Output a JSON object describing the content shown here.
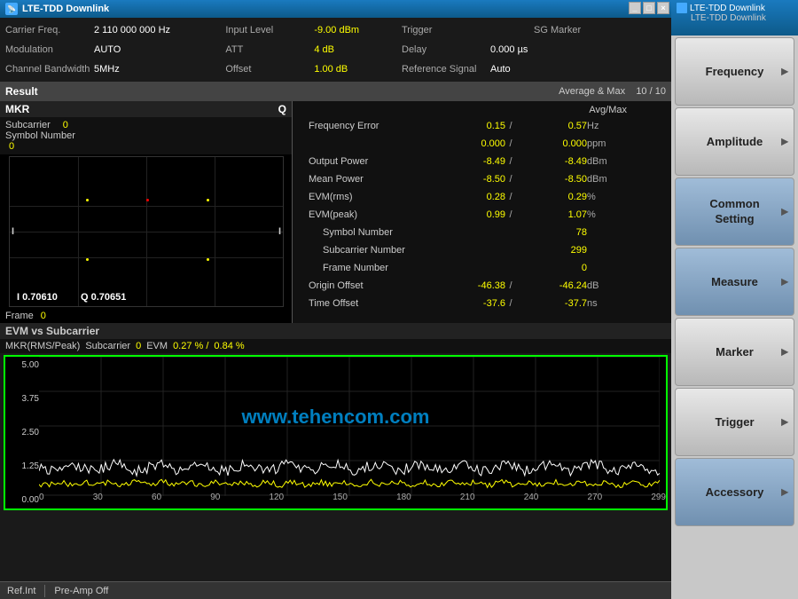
{
  "titlebar": {
    "title": "LTE-TDD Downlink",
    "icon": "LTE"
  },
  "sidebar_title": {
    "line1": "LTE-TDD Downlink",
    "line2": "LTE-TDD Downlink"
  },
  "info_rows": {
    "row1": {
      "carrier_label": "Carrier Freq.",
      "carrier_val": "2 110 000 000 Hz",
      "input_label": "Input Level",
      "input_val": "-9.00 dBm",
      "trigger_label": "Trigger",
      "trigger_val": "",
      "sg_marker_label": "SG Marker",
      "sg_marker_val": ""
    },
    "row2": {
      "mod_label": "Modulation",
      "mod_val": "AUTO",
      "att_label": "ATT",
      "att_val": "4 dB",
      "delay_label": "Delay",
      "delay_val": "0.000 µs"
    },
    "row3": {
      "ch_bw_label": "Channel Bandwidth",
      "ch_bw_val": "5MHz",
      "offset_label": "Offset",
      "offset_val": "1.00 dB",
      "ref_label": "Reference Signal",
      "ref_val": "Auto"
    }
  },
  "result_header": {
    "label": "Result",
    "avg_max_label": "Average & Max",
    "avg_val": "10",
    "sep": "/",
    "max_val": "10"
  },
  "mkr": {
    "title": "MKR",
    "q_label": "Q",
    "subcarrier_label": "Subcarrier",
    "subcarrier_val": "0",
    "symbol_number_label": "Symbol Number",
    "symbol_number_val": "0",
    "i_label": "I",
    "i_val": "0.70610",
    "q_val_label": "Q",
    "q_val": "0.70651",
    "frame_label": "Frame",
    "frame_val": "0"
  },
  "avg_max_header": "Avg/Max",
  "measurements": [
    {
      "label": "Frequency Error",
      "val": "0.15",
      "sep": "/",
      "avg": "0.57",
      "unit": "Hz"
    },
    {
      "label": "",
      "val": "0.000",
      "sep": "/",
      "avg": "0.000",
      "unit": "ppm"
    },
    {
      "label": "Output Power",
      "val": "-8.49",
      "sep": "/",
      "avg": "-8.49",
      "unit": "dBm"
    },
    {
      "label": "Mean Power",
      "val": "-8.50",
      "sep": "/",
      "avg": "-8.50",
      "unit": "dBm"
    },
    {
      "label": "EVM(rms)",
      "val": "0.28",
      "sep": "/",
      "avg": "0.29",
      "unit": "%"
    },
    {
      "label": "EVM(peak)",
      "val": "0.99",
      "sep": "/",
      "avg": "1.07",
      "unit": "%"
    },
    {
      "label": "Symbol Number",
      "val": "",
      "sep": "",
      "avg": "78",
      "unit": "",
      "indent": true
    },
    {
      "label": "Subcarrier Number",
      "val": "",
      "sep": "",
      "avg": "299",
      "unit": "",
      "indent": true
    },
    {
      "label": "Frame Number",
      "val": "",
      "sep": "",
      "avg": "0",
      "unit": "",
      "indent": true
    },
    {
      "label": "Origin Offset",
      "val": "-46.38",
      "sep": "/",
      "avg": "-46.24",
      "unit": "dB"
    },
    {
      "label": "Time Offset",
      "val": "-37.6",
      "sep": "/",
      "avg": "-37.7",
      "unit": "ns"
    }
  ],
  "evm_section": {
    "header": "EVM vs Subcarrier",
    "mkr_label": "MKR(RMS/Peak)",
    "subcarrier_label": "Subcarrier",
    "subcarrier_val": "0",
    "evm_label": "EVM",
    "evm_val": "0.27 % /",
    "evm_peak": "0.84 %",
    "y_labels": [
      "5.00",
      "3.75",
      "2.50",
      "1.25",
      "0.00"
    ],
    "x_labels": [
      "0",
      "30",
      "60",
      "90",
      "120",
      "150",
      "180",
      "210",
      "240",
      "270",
      "299"
    ]
  },
  "status_bar": {
    "ref": "Ref.Int",
    "preamp": "Pre-Amp Off"
  },
  "sidebar_buttons": [
    {
      "id": "frequency",
      "label": "Frequency",
      "highlighted": false
    },
    {
      "id": "amplitude",
      "label": "Amplitude",
      "highlighted": false
    },
    {
      "id": "common-setting",
      "label": "Common\nSetting",
      "highlighted": false
    },
    {
      "id": "measure",
      "label": "Measure",
      "highlighted": false
    },
    {
      "id": "marker",
      "label": "Marker",
      "highlighted": false
    },
    {
      "id": "trigger",
      "label": "Trigger",
      "highlighted": false
    },
    {
      "id": "accessory",
      "label": "Accessory",
      "highlighted": false
    }
  ],
  "watermark": "www.tehencom.com",
  "colors": {
    "accent_yellow": "#ffff00",
    "accent_cyan": "#00aaff",
    "accent_green": "#00ff00",
    "grid_green": "#008800"
  }
}
